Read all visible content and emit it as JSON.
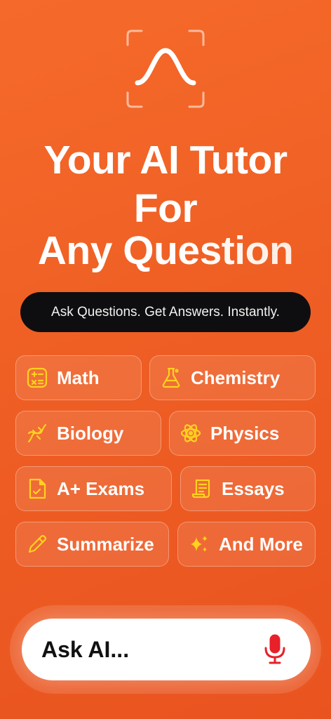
{
  "app": {
    "headline": {
      "line1": "Your AI Tutor",
      "line2": "For",
      "line3": "Any Question"
    },
    "tagline": "Ask Questions. Get Answers. Instantly.",
    "chips": [
      {
        "label": "Math",
        "icon": "calculator-icon"
      },
      {
        "label": "Chemistry",
        "icon": "flask-icon"
      },
      {
        "label": "Biology",
        "icon": "dna-icon"
      },
      {
        "label": "Physics",
        "icon": "atom-icon"
      },
      {
        "label": "A+ Exams",
        "icon": "document-check-icon"
      },
      {
        "label": "Essays",
        "icon": "scroll-icon"
      },
      {
        "label": "Summarize",
        "icon": "pencil-icon"
      },
      {
        "label": "And More",
        "icon": "sparkles-icon"
      }
    ],
    "ask": {
      "placeholder": "Ask AI...",
      "mic_icon": "microphone-icon"
    },
    "colors": {
      "background": "#ef5f24",
      "icon_accent": "#ffd21f",
      "mic": "#e8202a",
      "tagline_bg": "#0e0e10"
    }
  }
}
